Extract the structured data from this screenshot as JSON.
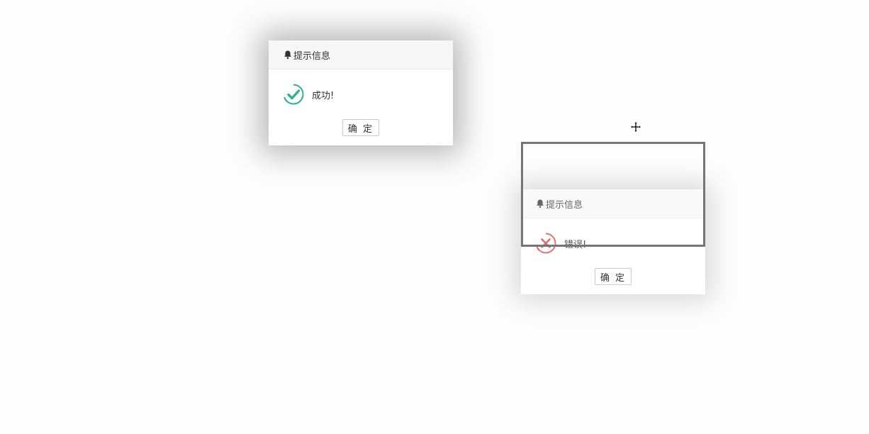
{
  "dialogs": {
    "success": {
      "title": "提示信息",
      "message": "成功!",
      "ok_label": "确 定",
      "status_icon": "check-circle-icon",
      "accent": "#2bb09a"
    },
    "error": {
      "title": "提示信息",
      "message": "错误!",
      "ok_label": "确 定",
      "status_icon": "x-circle-icon",
      "accent": "#d9534f"
    }
  },
  "cursor": "move-cursor-icon",
  "colors": {
    "header_bg": "#f6f6f6",
    "drag_outline": "#757575"
  }
}
